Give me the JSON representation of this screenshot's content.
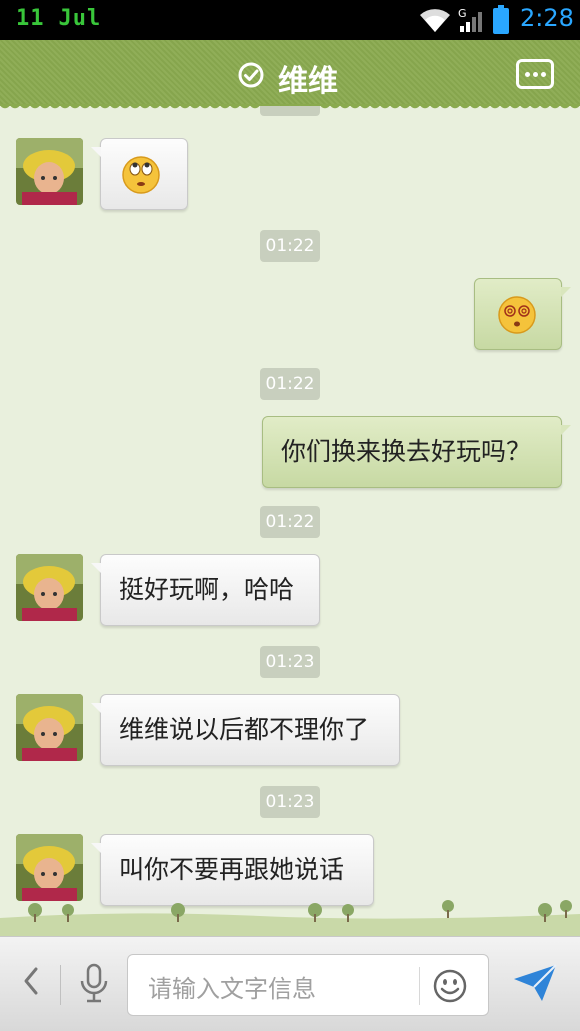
{
  "status_bar": {
    "day": "11",
    "month": "Jul",
    "time": "2:28",
    "icons": [
      "wifi-icon",
      "signal-icon",
      "battery-icon"
    ]
  },
  "header": {
    "title": "维维",
    "status_icon": "check-circle-icon",
    "menu_icon": "more-dots-icon"
  },
  "messages": [
    {
      "side": "left",
      "type": "emoji",
      "emoji": "rolling-eyes-emoji"
    },
    {
      "timestamp": "01:22"
    },
    {
      "side": "right",
      "type": "emoji",
      "emoji": "dizzy-emoji"
    },
    {
      "timestamp": "01:22"
    },
    {
      "side": "right",
      "type": "text",
      "text": "你们换来换去好玩吗？"
    },
    {
      "timestamp": "01:22"
    },
    {
      "side": "left",
      "type": "text",
      "text": "挺好玩啊，哈哈"
    },
    {
      "timestamp": "01:23"
    },
    {
      "side": "left",
      "type": "text",
      "text": "维维说以后都不理你了"
    },
    {
      "timestamp": "01:23"
    },
    {
      "side": "left",
      "type": "text",
      "text": "叫你不要再跟她说话"
    }
  ],
  "input_bar": {
    "placeholder": "请输入文字信息",
    "icons": [
      "back-chevron-icon",
      "microphone-icon",
      "smiley-icon",
      "send-icon"
    ]
  },
  "colors": {
    "header": "#8aaa4f",
    "chat_background": "#e9f0dd",
    "bubble_right": "#c7d9a3",
    "bubble_left": "#f2f2f2",
    "timestamp_badge": "#c8cfbe",
    "send_icon": "#2f84d8",
    "status_time": "#2aa7ff",
    "status_date": "#39c63a"
  }
}
